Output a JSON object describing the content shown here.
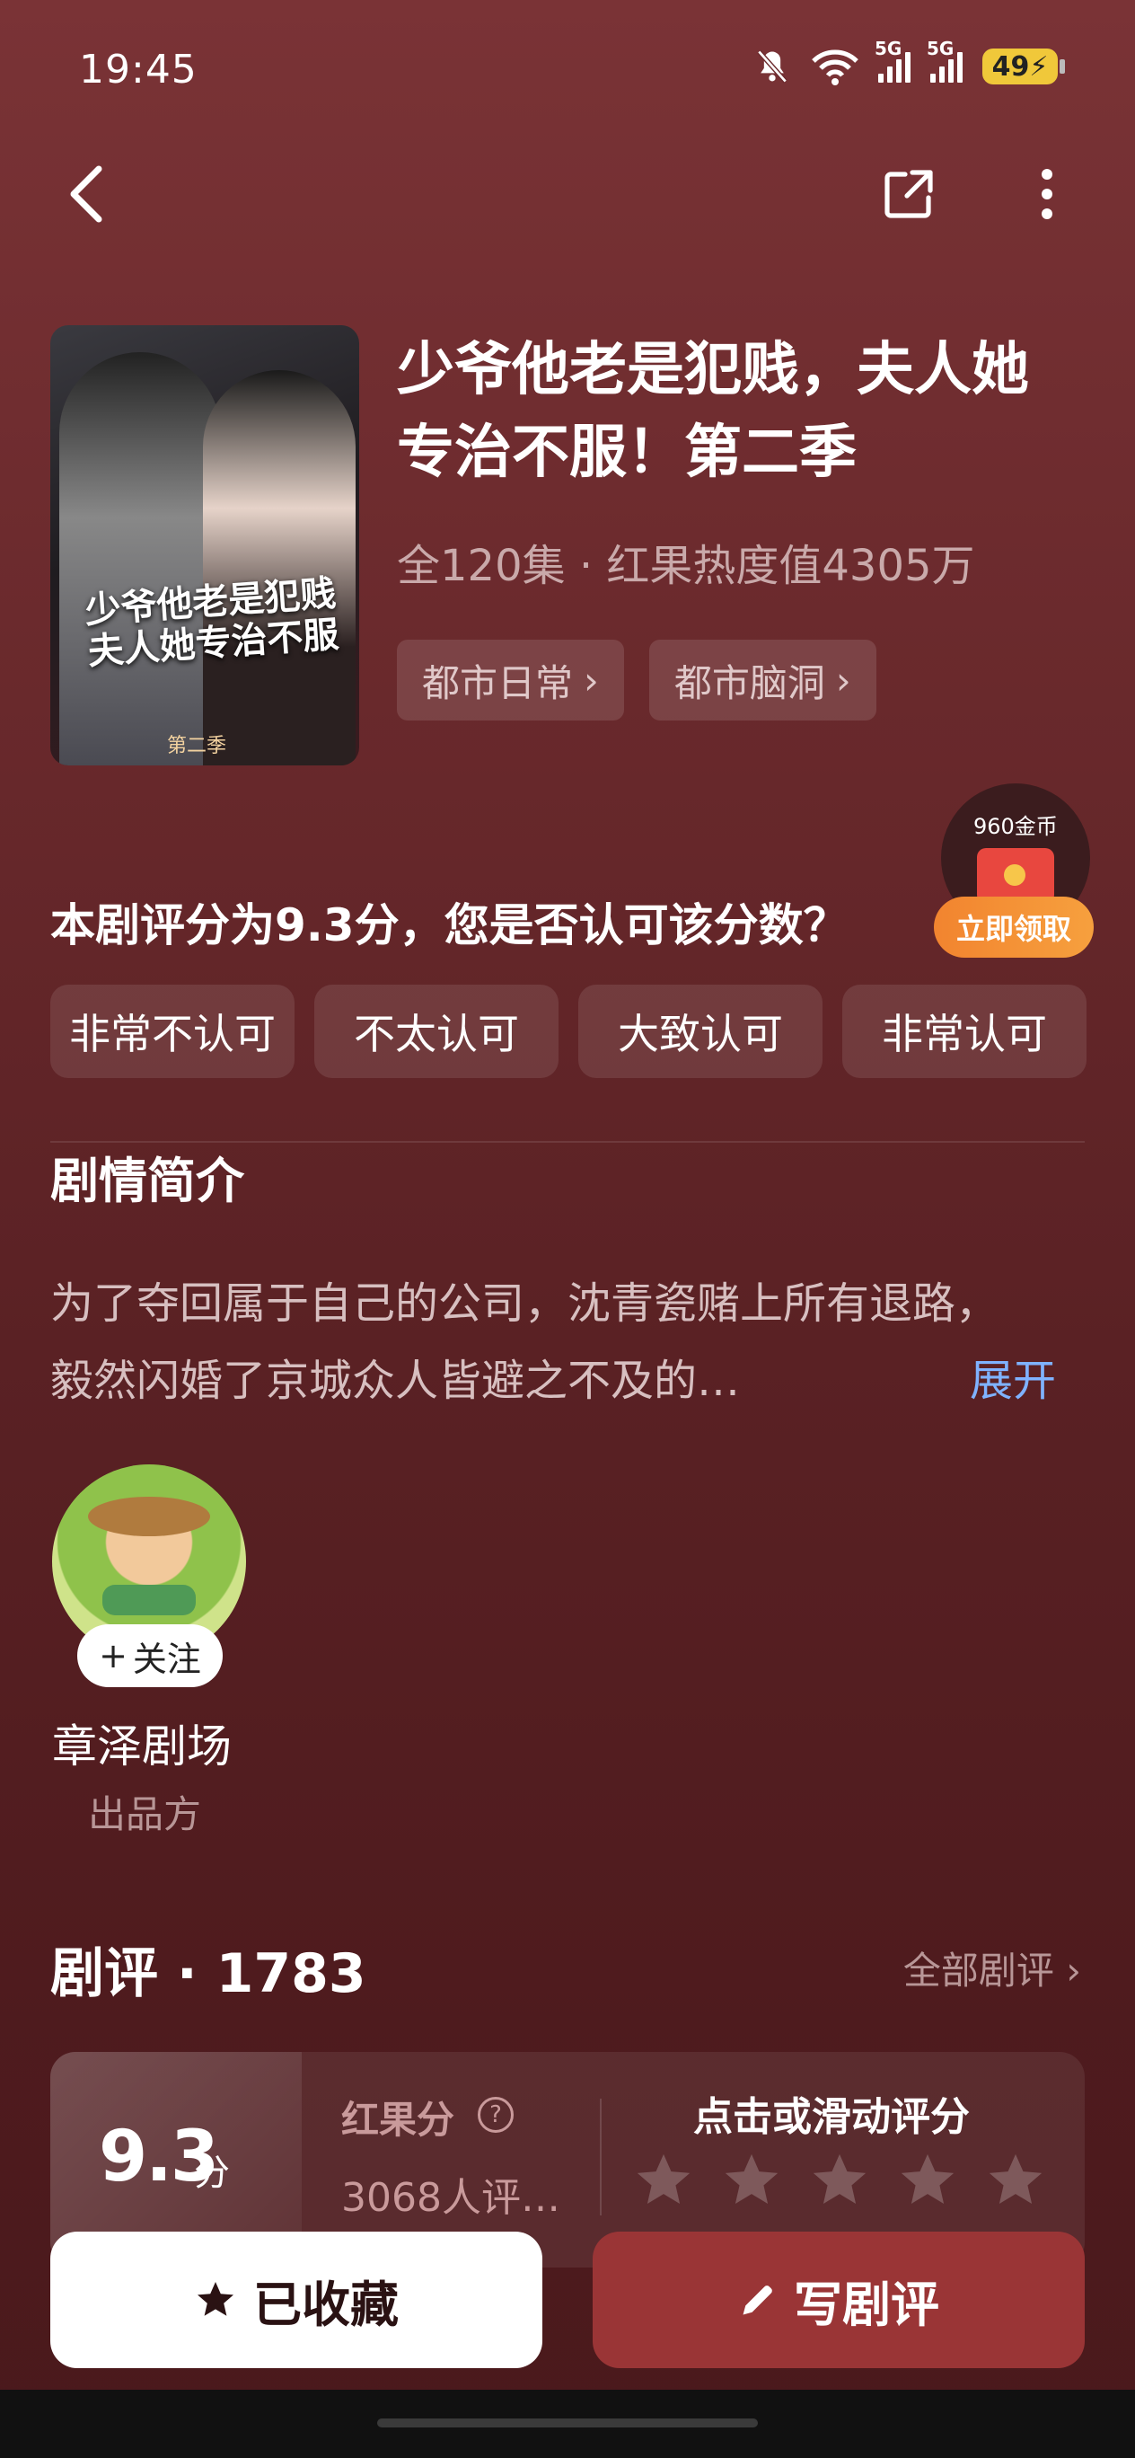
{
  "status_bar": {
    "time": "19:45",
    "battery": "49",
    "net1": "5G",
    "net2": "5G"
  },
  "drama": {
    "title": "少爷他老是犯贱，夫人她专治不服！第二季",
    "meta": "全120集 · 红果热度值4305万",
    "tags": [
      "都市日常",
      "都市脑洞"
    ],
    "cover_title": "少爷他老是犯贱夫人她专治不服",
    "cover_subtitle": "第二季"
  },
  "rating_question": {
    "text": "本剧评分为9.3分，您是否认可该分数？",
    "options": [
      "非常不认可",
      "不太认可",
      "大致认可",
      "非常认可"
    ]
  },
  "coin_promo": {
    "amount": "960金币",
    "button": "立即领取"
  },
  "synopsis": {
    "title": "剧情简介",
    "text": "为了夺回属于自己的公司，沈青瓷赌上所有退路，毅然闪婚了京城众人皆避之不及的…",
    "expand": "展开"
  },
  "producer": {
    "follow": "关注",
    "name": "章泽剧场",
    "role": "出品方"
  },
  "reviews": {
    "title": "剧评 · 1783",
    "all": "全部剧评",
    "score": "9.3",
    "score_unit": "分",
    "score_label": "红果分",
    "raters": "3068人评…",
    "tap_rate": "点击或滑动评分",
    "stars": 5
  },
  "actions": {
    "favorited": "已收藏",
    "write_review": "写剧评"
  },
  "colors": {
    "accent": "#9a3536",
    "link": "#7fb2ff",
    "promo": "#f2842f"
  }
}
